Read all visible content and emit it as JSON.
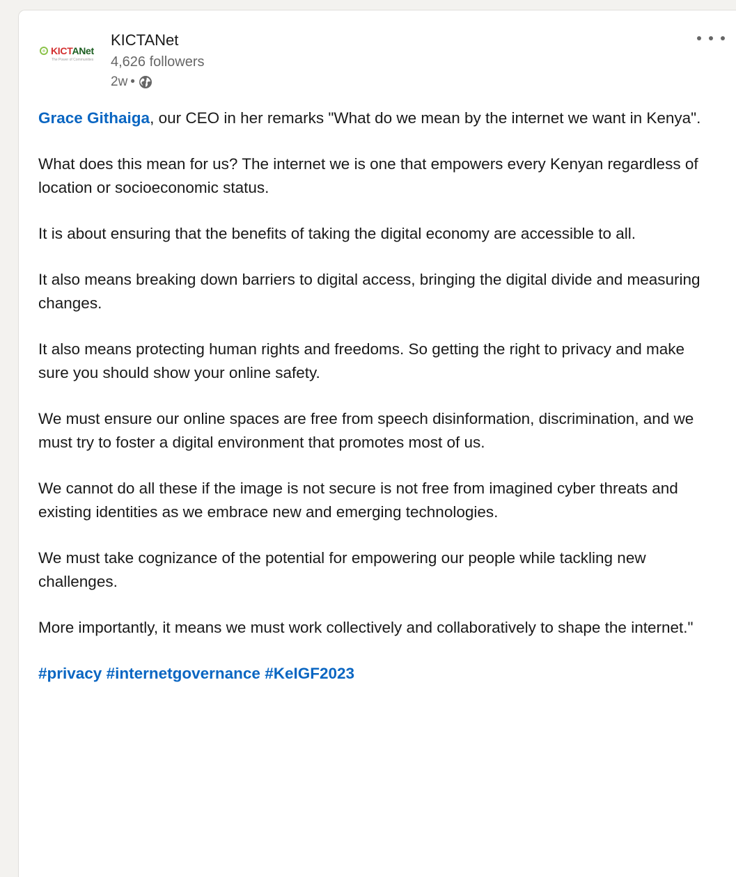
{
  "post": {
    "author": {
      "name": "KICTANet",
      "followers": "4,626 followers",
      "time": "2w",
      "separator": "•",
      "visibility_icon": "globe-icon",
      "logo": {
        "word_red": "KICT",
        "word_green": "ANet",
        "tagline": "The Power of Communities"
      }
    },
    "menu_icon": "ellipsis-horizontal-icon",
    "body": {
      "mention": "Grace Githaiga",
      "intro_rest": ", our CEO in her remarks \"What do we mean by the internet we want in Kenya\".",
      "paragraphs": [
        "What does this mean for us? The internet we is one that empowers every Kenyan regardless of location or socioeconomic status.",
        "It is about ensuring that the benefits of taking the digital economy are accessible to all.",
        "It also means breaking down barriers to digital access, bringing the digital divide and measuring changes.",
        "It also means protecting human rights and freedoms. So getting the right to privacy and make sure you should show your online safety.",
        "We must ensure our online spaces are free from speech disinformation, discrimination, and we must try to foster a digital environment that promotes most of us.",
        "We cannot do all these if the image is not secure is not free from imagined cyber threats and existing identities as we embrace new and emerging technologies.",
        "We must take cognizance of the potential for empowering our people while tackling new challenges.",
        "More importantly, it means we must work collectively and collaboratively to shape the internet.\""
      ],
      "hashtags": [
        "#privacy",
        "#internetgovernance",
        "#KeIGF2023"
      ]
    },
    "colors": {
      "link": "#0a66c2",
      "text": "#191919",
      "muted": "#666666",
      "background": "#f3f2ef",
      "card": "#ffffff"
    }
  }
}
